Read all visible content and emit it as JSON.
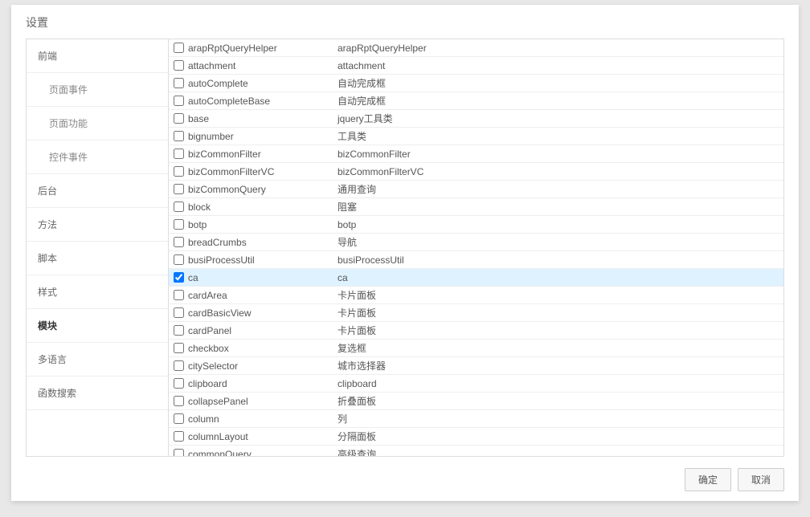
{
  "dialog": {
    "title": "设置",
    "ok_label": "确定",
    "cancel_label": "取消"
  },
  "sidebar": {
    "items": [
      {
        "label": "前端",
        "active": false,
        "child": false
      },
      {
        "label": "页面事件",
        "active": false,
        "child": true
      },
      {
        "label": "页面功能",
        "active": false,
        "child": true
      },
      {
        "label": "控件事件",
        "active": false,
        "child": true
      },
      {
        "label": "后台",
        "active": false,
        "child": false
      },
      {
        "label": "方法",
        "active": false,
        "child": false
      },
      {
        "label": "脚本",
        "active": false,
        "child": false
      },
      {
        "label": "样式",
        "active": false,
        "child": false
      },
      {
        "label": "模块",
        "active": true,
        "child": false
      },
      {
        "label": "多语言",
        "active": false,
        "child": false
      },
      {
        "label": "函数搜索",
        "active": false,
        "child": false
      }
    ]
  },
  "modules": [
    {
      "name": "arapRptQueryHelper",
      "desc": "arapRptQueryHelper",
      "checked": false
    },
    {
      "name": "attachment",
      "desc": "attachment",
      "checked": false
    },
    {
      "name": "autoComplete",
      "desc": "自动完成框",
      "checked": false
    },
    {
      "name": "autoCompleteBase",
      "desc": "自动完成框",
      "checked": false
    },
    {
      "name": "base",
      "desc": "jquery工具类",
      "checked": false
    },
    {
      "name": "bignumber",
      "desc": "工具类",
      "checked": false
    },
    {
      "name": "bizCommonFilter",
      "desc": "bizCommonFilter",
      "checked": false
    },
    {
      "name": "bizCommonFilterVC",
      "desc": "bizCommonFilterVC",
      "checked": false
    },
    {
      "name": "bizCommonQuery",
      "desc": "通用查询",
      "checked": false
    },
    {
      "name": "block",
      "desc": "阻塞",
      "checked": false
    },
    {
      "name": "botp",
      "desc": "botp",
      "checked": false
    },
    {
      "name": "breadCrumbs",
      "desc": "导航",
      "checked": false
    },
    {
      "name": "busiProcessUtil",
      "desc": "busiProcessUtil",
      "checked": false
    },
    {
      "name": "ca",
      "desc": "ca",
      "checked": true
    },
    {
      "name": "cardArea",
      "desc": "卡片面板",
      "checked": false
    },
    {
      "name": "cardBasicView",
      "desc": "卡片面板",
      "checked": false
    },
    {
      "name": "cardPanel",
      "desc": "卡片面板",
      "checked": false
    },
    {
      "name": "checkbox",
      "desc": "复选框",
      "checked": false
    },
    {
      "name": "citySelector",
      "desc": "城市选择器",
      "checked": false
    },
    {
      "name": "clipboard",
      "desc": "clipboard",
      "checked": false
    },
    {
      "name": "collapsePanel",
      "desc": "折叠面板",
      "checked": false
    },
    {
      "name": "column",
      "desc": "列",
      "checked": false
    },
    {
      "name": "columnLayout",
      "desc": "分隔面板",
      "checked": false
    },
    {
      "name": "commonQuery",
      "desc": "高级查询",
      "checked": false
    }
  ]
}
